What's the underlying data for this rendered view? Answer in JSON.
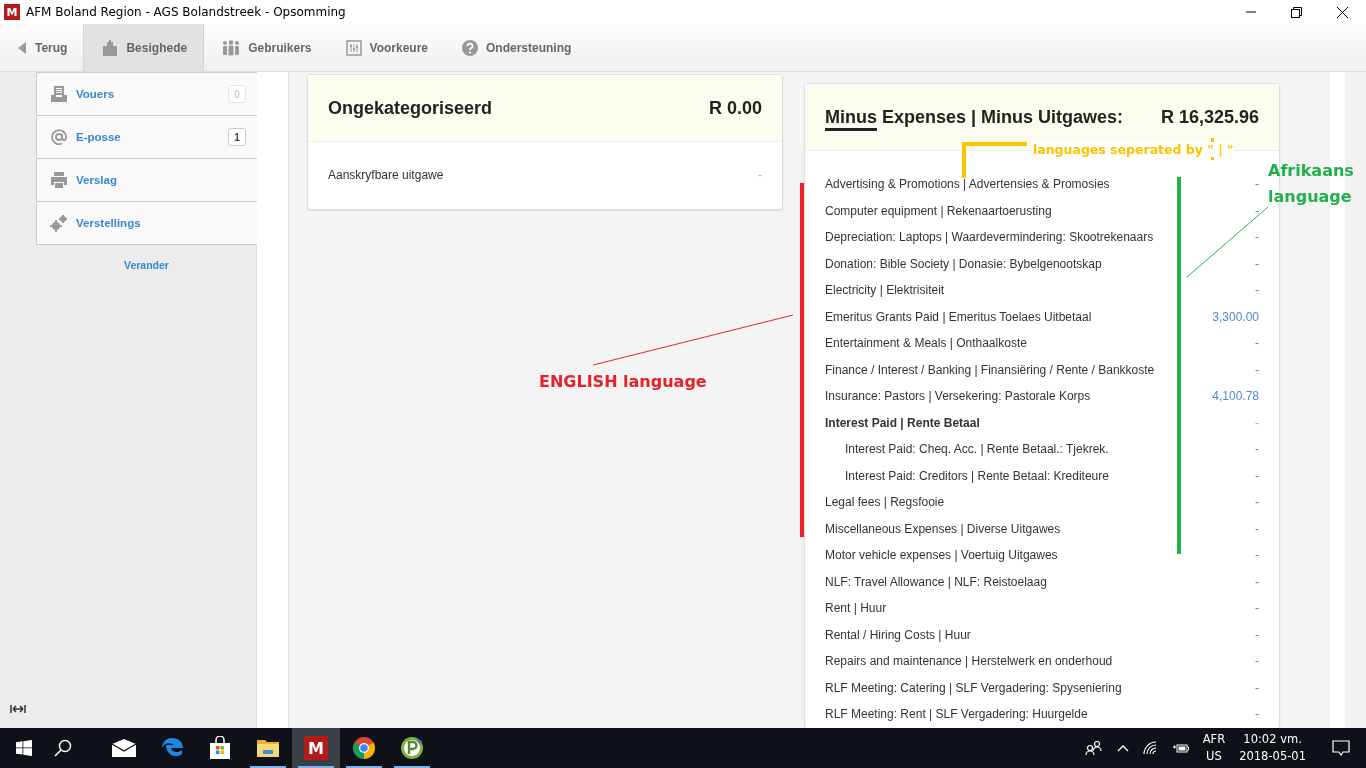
{
  "window": {
    "title": "AFM Boland Region - AGS Bolandstreek - Opsomming",
    "app_letter": "M"
  },
  "nav": [
    {
      "label": "Terug",
      "kind": "back",
      "selected": false
    },
    {
      "label": "Besighede",
      "kind": "building",
      "selected": true
    },
    {
      "label": "Gebruikers",
      "kind": "users",
      "selected": false
    },
    {
      "label": "Voorkeure",
      "kind": "sliders",
      "selected": false
    },
    {
      "label": "Ondersteuning",
      "kind": "help",
      "selected": false
    }
  ],
  "sidebar": {
    "items": [
      {
        "label": "Vouers",
        "kind": "tray",
        "badge": "0",
        "disabled": true
      },
      {
        "label": "E-posse",
        "kind": "at",
        "badge": "1",
        "disabled": false
      },
      {
        "label": "Verslag",
        "kind": "printer"
      },
      {
        "label": "Verstellings",
        "kind": "gears"
      }
    ],
    "link": "Verander"
  },
  "cards": [
    {
      "title": "Ongekategoriseerd",
      "total": "R 0.00",
      "rows": [
        {
          "label": "Aanskryfbare uitgawe",
          "amount": "-",
          "kind": "plain"
        }
      ]
    },
    {
      "title_lead": "Minus",
      "title": " Expenses | Minus Uitgawes:",
      "total": "R 16,325.96",
      "rows": [
        {
          "label": "Advertising & Promotions | Advertensies & Promosies",
          "amount": "-",
          "kind": "item"
        },
        {
          "label": "Computer equipment | Rekenaartoerusting",
          "amount": "-",
          "kind": "item"
        },
        {
          "label": "Depreciation: Laptops | Waardevermindering: Skootrekenaars",
          "amount": "-",
          "kind": "item"
        },
        {
          "label": "Donation: Bible Society | Donasie: Bybelgenootskap",
          "amount": "-",
          "kind": "item"
        },
        {
          "label": "Electricity | Elektrisiteit",
          "amount": "-",
          "kind": "item"
        },
        {
          "label": "Emeritus Grants Paid | Emeritus Toelaes Uitbetaal",
          "amount": "3,300.00",
          "kind": "item"
        },
        {
          "label": "Entertainment & Meals | Onthaalkoste",
          "amount": "-",
          "kind": "item"
        },
        {
          "label": "Finance / Interest / Banking | Finansiëring / Rente / Bankkoste",
          "amount": "-",
          "kind": "item"
        },
        {
          "label": "Insurance: Pastors | Versekering: Pastorale Korps",
          "amount": "4,100.78",
          "kind": "item"
        },
        {
          "label": "Interest Paid | Rente Betaal",
          "amount": "-",
          "kind": "group"
        },
        {
          "label": "Interest Paid: Cheq. Acc. | Rente Betaal.: Tjekrek.",
          "amount": "-",
          "kind": "subitem"
        },
        {
          "label": "Interest Paid: Creditors | Rente Betaal: Krediteure",
          "amount": "-",
          "kind": "subitem"
        },
        {
          "label": "Legal fees | Regsfooie",
          "amount": "-",
          "kind": "item"
        },
        {
          "label": "Miscellaneous Expenses | Diverse Uitgawes",
          "amount": "-",
          "kind": "item"
        },
        {
          "label": "Motor vehicle expenses | Voertuig Uitgawes",
          "amount": "-",
          "kind": "item"
        },
        {
          "label": "NLF: Travel Allowance | NLF: Reistoelaag",
          "amount": "-",
          "kind": "item"
        },
        {
          "label": "Rent | Huur",
          "amount": "-",
          "kind": "item"
        },
        {
          "label": "Rental / Hiring Costs | Huur",
          "amount": "-",
          "kind": "item"
        },
        {
          "label": "Repairs and maintenance | Herstelwerk en onderhoud",
          "amount": "-",
          "kind": "item"
        },
        {
          "label": "RLF Meeting: Catering | SLF Vergadering: Spyseniering",
          "amount": "-",
          "kind": "item"
        },
        {
          "label": "RLF Meeting: Rent | SLF Vergadering: Huurgelde",
          "amount": "-",
          "kind": "item"
        }
      ]
    }
  ],
  "annotations": [
    {
      "kind": "english",
      "text": "ENGLISH language",
      "color": "#e8202a"
    },
    {
      "kind": "afrikaans",
      "text": "Afrikaans language",
      "color": "#22b04b"
    },
    {
      "kind": "separator",
      "text": "languages seperated by \" | \"",
      "color": "#fbc400"
    }
  ],
  "taskbar": {
    "apps": [
      {
        "kind": "mail",
        "running": false,
        "selected": false
      },
      {
        "kind": "edge",
        "running": false,
        "selected": false
      },
      {
        "kind": "store",
        "running": false,
        "selected": false
      },
      {
        "kind": "folder",
        "running": true,
        "selected": false
      },
      {
        "kind": "app",
        "label": "M",
        "running": true,
        "selected": true
      },
      {
        "kind": "chrome",
        "running": true,
        "selected": false
      },
      {
        "kind": "p",
        "running": true,
        "selected": false
      }
    ],
    "language": "AFR",
    "region": "US",
    "time": "10:02 vm.",
    "date": "2018-05-01"
  }
}
